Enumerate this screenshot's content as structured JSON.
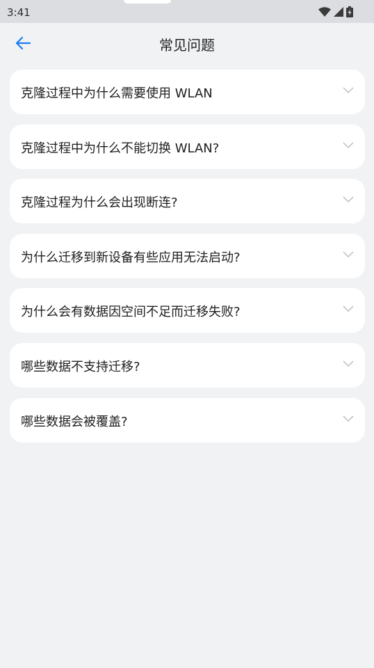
{
  "status_bar": {
    "time": "3:41",
    "icons": [
      "wifi-icon",
      "signal-icon",
      "battery-charging-icon"
    ]
  },
  "header": {
    "title": "常见问题",
    "back_icon": "arrow-left-icon",
    "accent_color": "#1a7cf5"
  },
  "faq": {
    "expand_icon": "chevron-down-icon",
    "items": [
      {
        "label": "克隆过程中为什么需要使用 WLAN"
      },
      {
        "label": "克隆过程中为什么不能切换 WLAN?"
      },
      {
        "label": "克隆过程为什么会出现断连?"
      },
      {
        "label": "为什么迁移到新设备有些应用无法启动?"
      },
      {
        "label": "为什么会有数据因空间不足而迁移失败?"
      },
      {
        "label": "哪些数据不支持迁移?"
      },
      {
        "label": "哪些数据会被覆盖?"
      }
    ]
  }
}
